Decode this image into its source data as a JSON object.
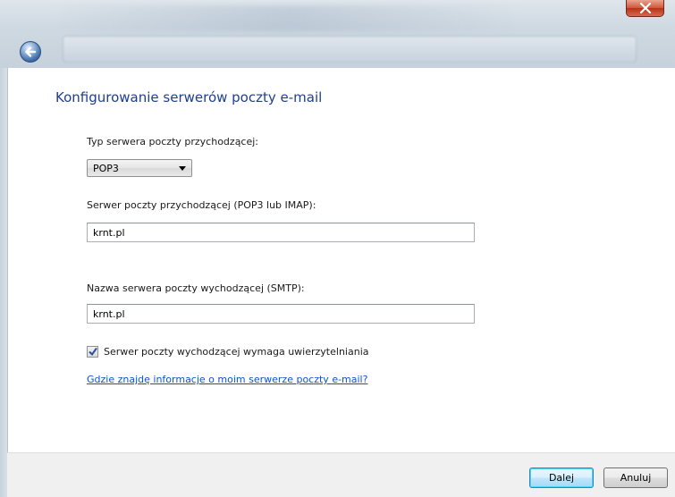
{
  "window": {
    "close_icon": "close-icon",
    "back_icon": "back-arrow-icon"
  },
  "main": {
    "heading": "Konfigurowanie serwerów poczty e-mail",
    "incoming_type_label": "Typ serwera poczty przychodzącej:",
    "incoming_type_value": "POP3",
    "incoming_server_label": "Serwer poczty przychodzącej (POP3 lub IMAP):",
    "incoming_server_value": "krnt.pl",
    "outgoing_server_label": "Nazwa serwera poczty wychodzącej (SMTP):",
    "outgoing_server_value": "krnt.pl",
    "auth_checkbox_label": "Serwer poczty wychodzącej wymaga uwierzytelniania",
    "auth_checkbox_checked": true,
    "help_link": "Gdzie znajdę informacje o moim serwerze poczty e-mail?"
  },
  "footer": {
    "next_label": "Dalej",
    "cancel_label": "Anuluj"
  },
  "colors": {
    "heading": "#1e3f8f",
    "link": "#0a55c8",
    "close_button": "#c9452b"
  }
}
